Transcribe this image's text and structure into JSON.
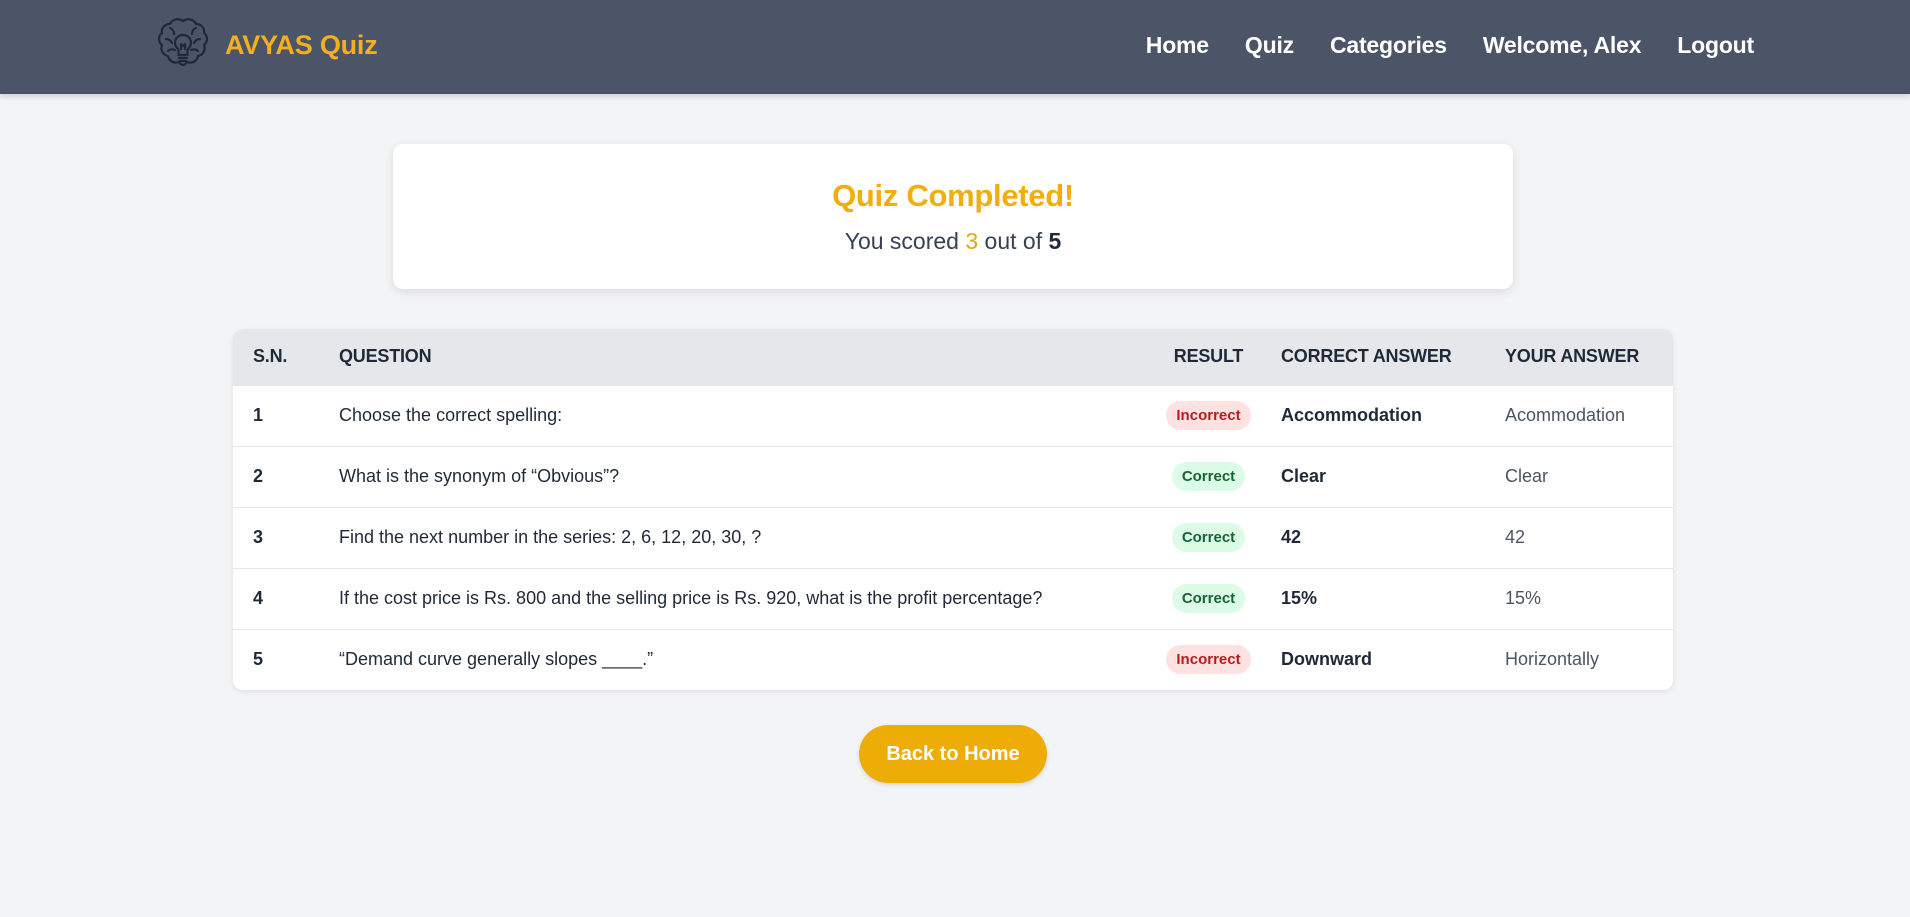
{
  "header": {
    "brand": "AVYAS Quiz",
    "logo_icon": "brain-lightbulb-icon",
    "nav": [
      {
        "label": "Home"
      },
      {
        "label": "Quiz"
      },
      {
        "label": "Categories"
      },
      {
        "label": "Welcome, Alex"
      },
      {
        "label": "Logout"
      }
    ]
  },
  "score": {
    "title": "Quiz Completed!",
    "prefix": "You scored ",
    "value": "3",
    "middle": " out of ",
    "total": "5"
  },
  "table": {
    "headers": {
      "sn": "S.N.",
      "question": "QUESTION",
      "result": "RESULT",
      "correct": "CORRECT ANSWER",
      "yours": "YOUR ANSWER"
    },
    "rows": [
      {
        "sn": "1",
        "question": "Choose the correct spelling:",
        "result": "Incorrect",
        "status": "incorrect",
        "correct": "Accommodation",
        "yours": "Acommodation"
      },
      {
        "sn": "2",
        "question": "What is the synonym of “Obvious”?",
        "result": "Correct",
        "status": "correct",
        "correct": "Clear",
        "yours": "Clear"
      },
      {
        "sn": "3",
        "question": "Find the next number in the series: 2, 6, 12, 20, 30, ?",
        "result": "Correct",
        "status": "correct",
        "correct": "42",
        "yours": "42"
      },
      {
        "sn": "4",
        "question": "If the cost price is Rs. 800 and the selling price is Rs. 920, what is the profit percentage?",
        "result": "Correct",
        "status": "correct",
        "correct": "15%",
        "yours": "15%"
      },
      {
        "sn": "5",
        "question": "“Demand curve generally slopes ____.”",
        "result": "Incorrect",
        "status": "incorrect",
        "correct": "Downward",
        "yours": "Horizontally"
      }
    ]
  },
  "actions": {
    "back_label": "Back to Home"
  },
  "colors": {
    "header_bg": "#4b5567",
    "accent": "#f2b01e",
    "correct_bg": "#dcfce7",
    "incorrect_bg": "#fee2e2"
  }
}
